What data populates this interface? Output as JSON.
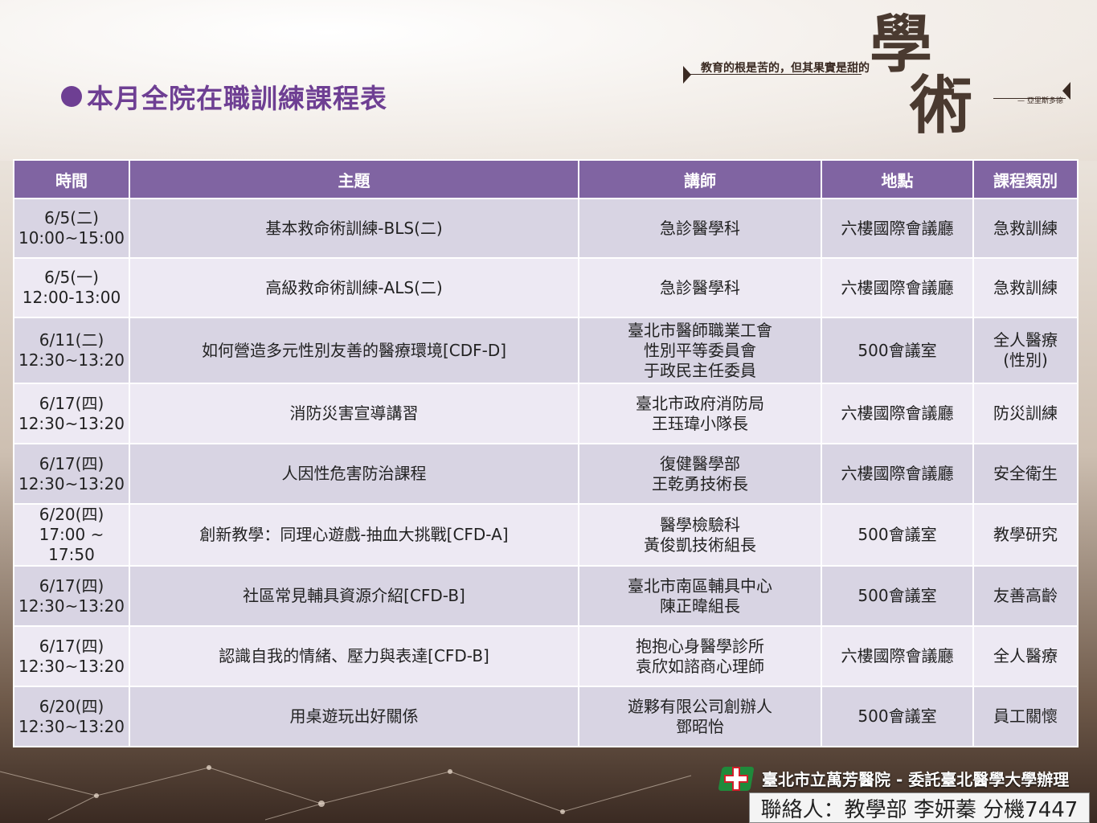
{
  "page_title": "本月全院在職訓練課程表",
  "banner": {
    "quote": "教育的根是苦的，但其果實是甜的",
    "big_char_1": "學",
    "big_char_2": "術",
    "author": "— 亞里斯多德"
  },
  "table": {
    "headers": [
      "時間",
      "主題",
      "講師",
      "地點",
      "課程類別"
    ],
    "rows": [
      {
        "date": "6/5(二)",
        "time": "10:00~15:00",
        "topic": "基本救命術訓練-BLS(二)",
        "lecturer": [
          "急診醫學科"
        ],
        "location": "六樓國際會議廳",
        "category": [
          "急救訓練"
        ]
      },
      {
        "date": "6/5(一)",
        "time": "12:00-13:00",
        "topic": "高級救命術訓練-ALS(二)",
        "lecturer": [
          "急診醫學科"
        ],
        "location": "六樓國際會議廳",
        "category": [
          "急救訓練"
        ]
      },
      {
        "date": "6/11(二)",
        "time": "12:30~13:20",
        "topic": "如何營造多元性別友善的醫療環境[CDF-D]",
        "lecturer": [
          "臺北市醫師職業工會",
          "性別平等委員會",
          "于政民主任委員"
        ],
        "location": "500會議室",
        "category": [
          "全人醫療",
          "(性別)"
        ]
      },
      {
        "date": "6/17(四)",
        "time": "12:30~13:20",
        "topic": "消防災害宣導講習",
        "lecturer": [
          "臺北市政府消防局",
          "王珏瑋小隊長"
        ],
        "location": "六樓國際會議廳",
        "category": [
          "防災訓練"
        ]
      },
      {
        "date": "6/17(四)",
        "time": "12:30~13:20",
        "topic": "人因性危害防治課程",
        "lecturer": [
          "復健醫學部",
          "王乾勇技術長"
        ],
        "location": "六樓國際會議廳",
        "category": [
          "安全衛生"
        ]
      },
      {
        "date": "6/20(四)",
        "time": "17:00 ~ 17:50",
        "topic": "創新教學：同理心遊戲-抽血大挑戰[CFD-A]",
        "lecturer": [
          "醫學檢驗科",
          "黃俊凱技術組長"
        ],
        "location": "500會議室",
        "category": [
          "教學研究"
        ]
      },
      {
        "date": "6/17(四)",
        "time": "12:30~13:20",
        "topic": "社區常見輔具資源介紹[CFD-B]",
        "lecturer": [
          "臺北市南區輔具中心",
          "陳正暐組長"
        ],
        "location": "500會議室",
        "category": [
          "友善高齡"
        ]
      },
      {
        "date": "6/17(四)",
        "time": "12:30~13:20",
        "topic": "認識自我的情緒、壓力與表達[CFD-B]",
        "lecturer": [
          "抱抱心身醫學診所",
          "袁欣如諮商心理師"
        ],
        "location": "六樓國際會議廳",
        "category": [
          "全人醫療"
        ]
      },
      {
        "date": "6/20(四)",
        "time": "12:30~13:20",
        "topic": "用桌遊玩出好關係",
        "lecturer": [
          "遊夥有限公司創辦人",
          "鄧昭怡"
        ],
        "location": "500會議室",
        "category": [
          "員工關懷"
        ]
      }
    ]
  },
  "footer": {
    "org": "臺北市立萬芳醫院 - 委託臺北醫學大學辦理",
    "contact": "聯絡人：教學部 李妍蓁 分機7447"
  },
  "colors": {
    "title": "#6e3f93",
    "header_bg": "#8064a2",
    "row_odd": "#d8d4e3",
    "row_even": "#ede9f3"
  }
}
